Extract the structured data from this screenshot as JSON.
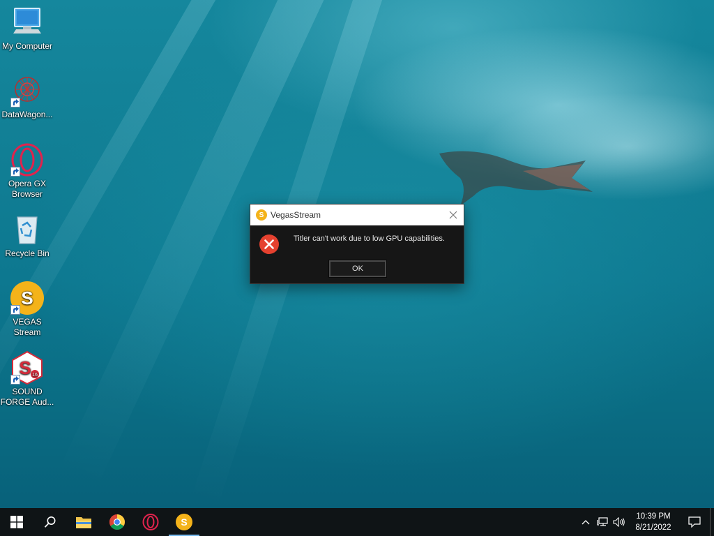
{
  "desktop": {
    "icons": [
      {
        "label": "My Computer",
        "icon": "computer-icon"
      },
      {
        "label": "DataWagon...",
        "icon": "datawagon-icon"
      },
      {
        "label": "Opera GX Browser",
        "icon": "opera-gx-icon"
      },
      {
        "label": "Recycle Bin",
        "icon": "recycle-bin-icon"
      },
      {
        "label": "VEGAS Stream",
        "icon": "vegas-stream-icon"
      },
      {
        "label": "SOUND FORGE Aud...",
        "icon": "sound-forge-icon"
      }
    ]
  },
  "dialog": {
    "title": "VegasStream",
    "app_icon_letter": "S",
    "message": "Titler can't work due to low GPU capabilities.",
    "ok_label": "OK",
    "icon": "error-icon"
  },
  "taskbar": {
    "pinned": [
      "start-icon",
      "search-icon",
      "file-explorer-icon",
      "chrome-icon",
      "opera-icon",
      "vegas-stream-icon"
    ],
    "vegas_letter": "S",
    "sound_forge_badge": "16",
    "clock": {
      "time": "10:39 PM",
      "date": "8/21/2022"
    }
  },
  "colors": {
    "taskbar_bg": "#0f1416",
    "dialog_bg": "#161616",
    "vegas_yellow": "#f4b31a",
    "error_red": "#e5412f"
  }
}
